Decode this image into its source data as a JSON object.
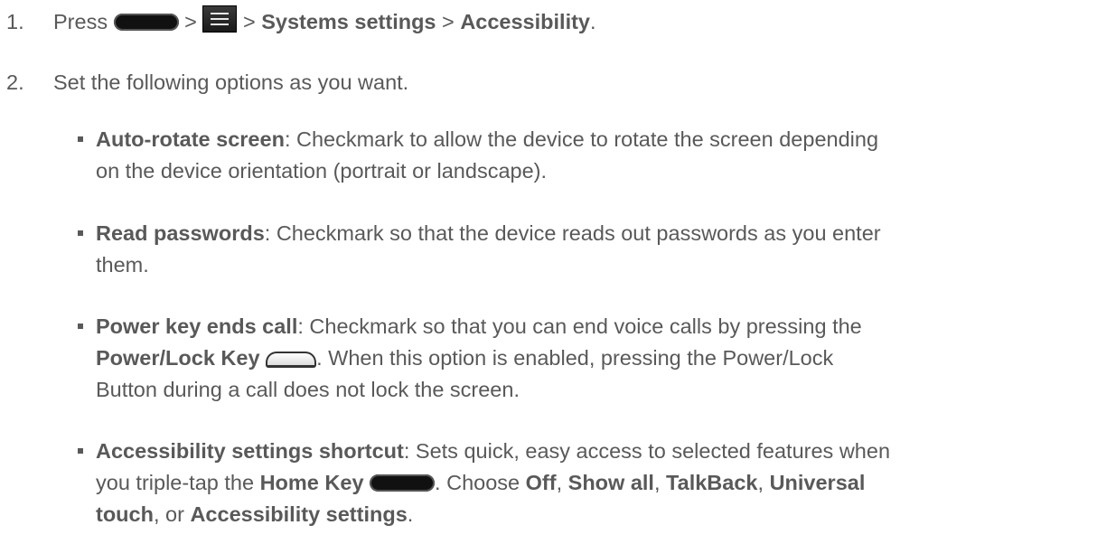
{
  "steps": [
    {
      "number": "1.",
      "press": "Press",
      "sep1": ">",
      "sep2": ">",
      "systems_settings": "Systems settings",
      "sep3": ">",
      "accessibility": "Accessibility",
      "end": "."
    },
    {
      "number": "2.",
      "text": "Set the following options as you want."
    }
  ],
  "options": [
    {
      "title": "Auto-rotate screen",
      "text_line1": ": Checkmark to allow the device to rotate the screen depending",
      "text_line2": "on the device orientation (portrait or landscape)."
    },
    {
      "title": "Read passwords",
      "text_line1": ": Checkmark so that the device reads out passwords as you enter",
      "text_line2": "them."
    },
    {
      "title": "Power key ends call",
      "text_line1": ": Checkmark so that you can end voice calls by pressing the",
      "key_name": "Power/Lock Key",
      "text_line2": ". When this option is enabled, pressing the Power/Lock",
      "text_line3": "Button during a call does not lock the screen."
    },
    {
      "title": "Accessibility settings shortcut",
      "text_line1": ": Sets quick, easy access to selected features when",
      "text_line2a": "you triple-tap the ",
      "key_name": "Home Key",
      "text_line2b": ". Choose ",
      "choice_off": "Off",
      "comma1": ", ",
      "choice_show_all": "Show all",
      "comma2": ", ",
      "choice_talkback": "TalkBack",
      "comma3": ", ",
      "choice_universal": "Universal",
      "choice_touch": "touch",
      "text_line3a": ", or ",
      "choice_accessibility": "Accessibility settings",
      "text_line3b": "."
    }
  ],
  "icons": {
    "home_key": "home-key",
    "menu_key": "menu-key",
    "power_key": "power-lock-key"
  }
}
